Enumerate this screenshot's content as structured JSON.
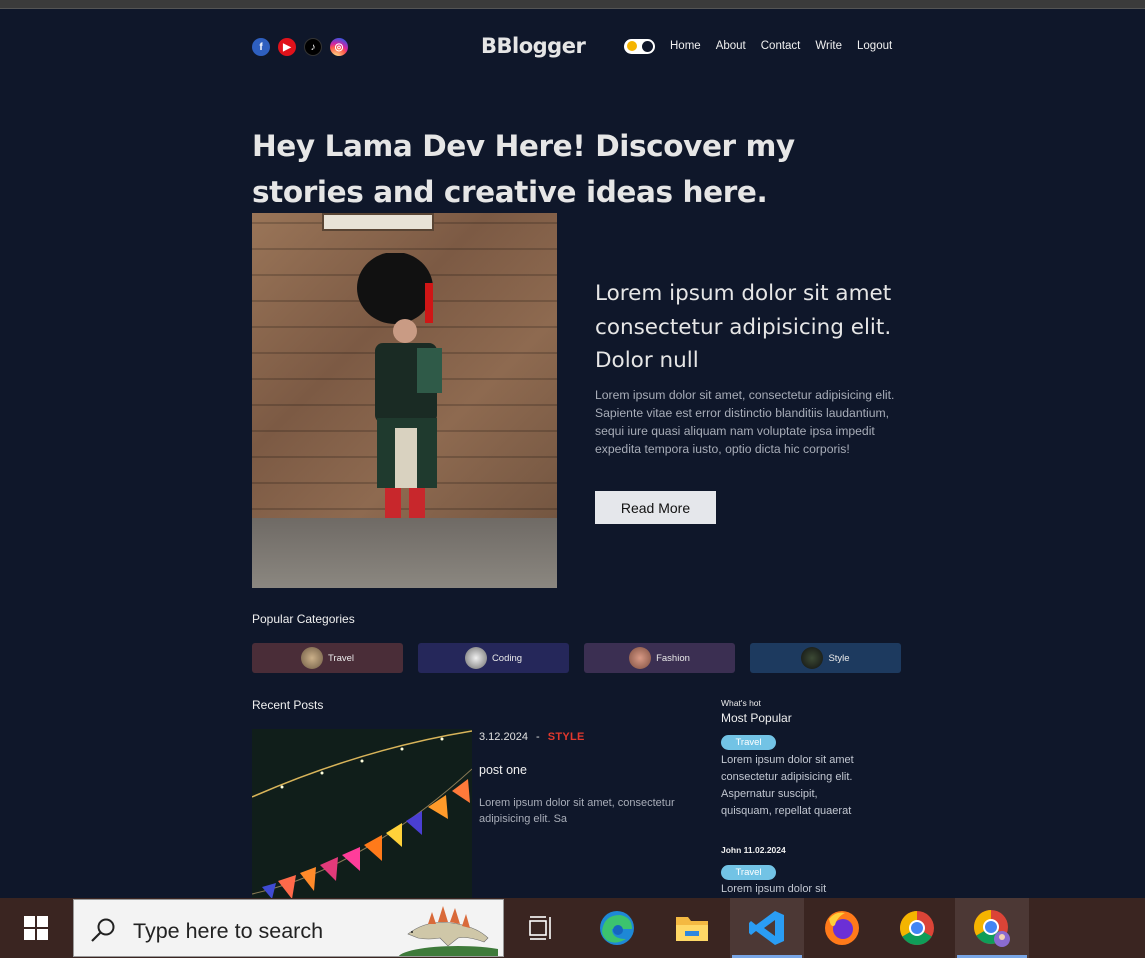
{
  "header": {
    "social_icons": [
      "facebook-icon",
      "youtube-icon",
      "tiktok-icon",
      "instagram-icon"
    ],
    "logo": "BBlogger",
    "nav": [
      "Home",
      "About",
      "Contact",
      "Write",
      "Logout"
    ]
  },
  "hero": {
    "bold": "Hey Lama Dev Here!",
    "rest": " Discover my stories and creative ideas here."
  },
  "featured": {
    "title": "Lorem ipsum dolor sit amet consectetur adipisicing elit. Dolor null",
    "desc": "Lorem ipsum dolor sit amet, consectetur adipisicing elit. Sapiente vitae est error distinctio blanditiis laudantium, sequi iure quasi aliquam nam voluptate ipsa impedit expedita tempora iusto, optio dicta hic corporis!",
    "button": "Read More"
  },
  "categories": {
    "heading": "Popular Categories",
    "items": [
      "Travel",
      "Coding",
      "Fashion",
      "Style"
    ]
  },
  "recent": {
    "heading": "Recent Posts",
    "post": {
      "date": "3.12.2024",
      "sep": "-",
      "category": "STYLE",
      "title": "post one",
      "desc": "Lorem ipsum dolor sit amet, consectetur adipisicing elit. Sa"
    }
  },
  "sidebar": {
    "subtitle": "What's hot",
    "title": "Most Popular",
    "items": [
      {
        "tag": "Travel",
        "desc": "Lorem ipsum dolor sit amet consectetur adipisicing elit. Aspernatur suscipit, quisquam, repellat quaerat",
        "author": "John 11.02.2024"
      },
      {
        "tag": "Travel",
        "desc": "Lorem ipsum dolor sit"
      }
    ]
  },
  "taskbar": {
    "search_placeholder": "Type here to search",
    "apps": [
      "task-view-icon",
      "edge-icon",
      "file-explorer-icon",
      "vscode-icon",
      "firefox-icon",
      "chrome-icon",
      "chrome-profile-icon"
    ]
  }
}
